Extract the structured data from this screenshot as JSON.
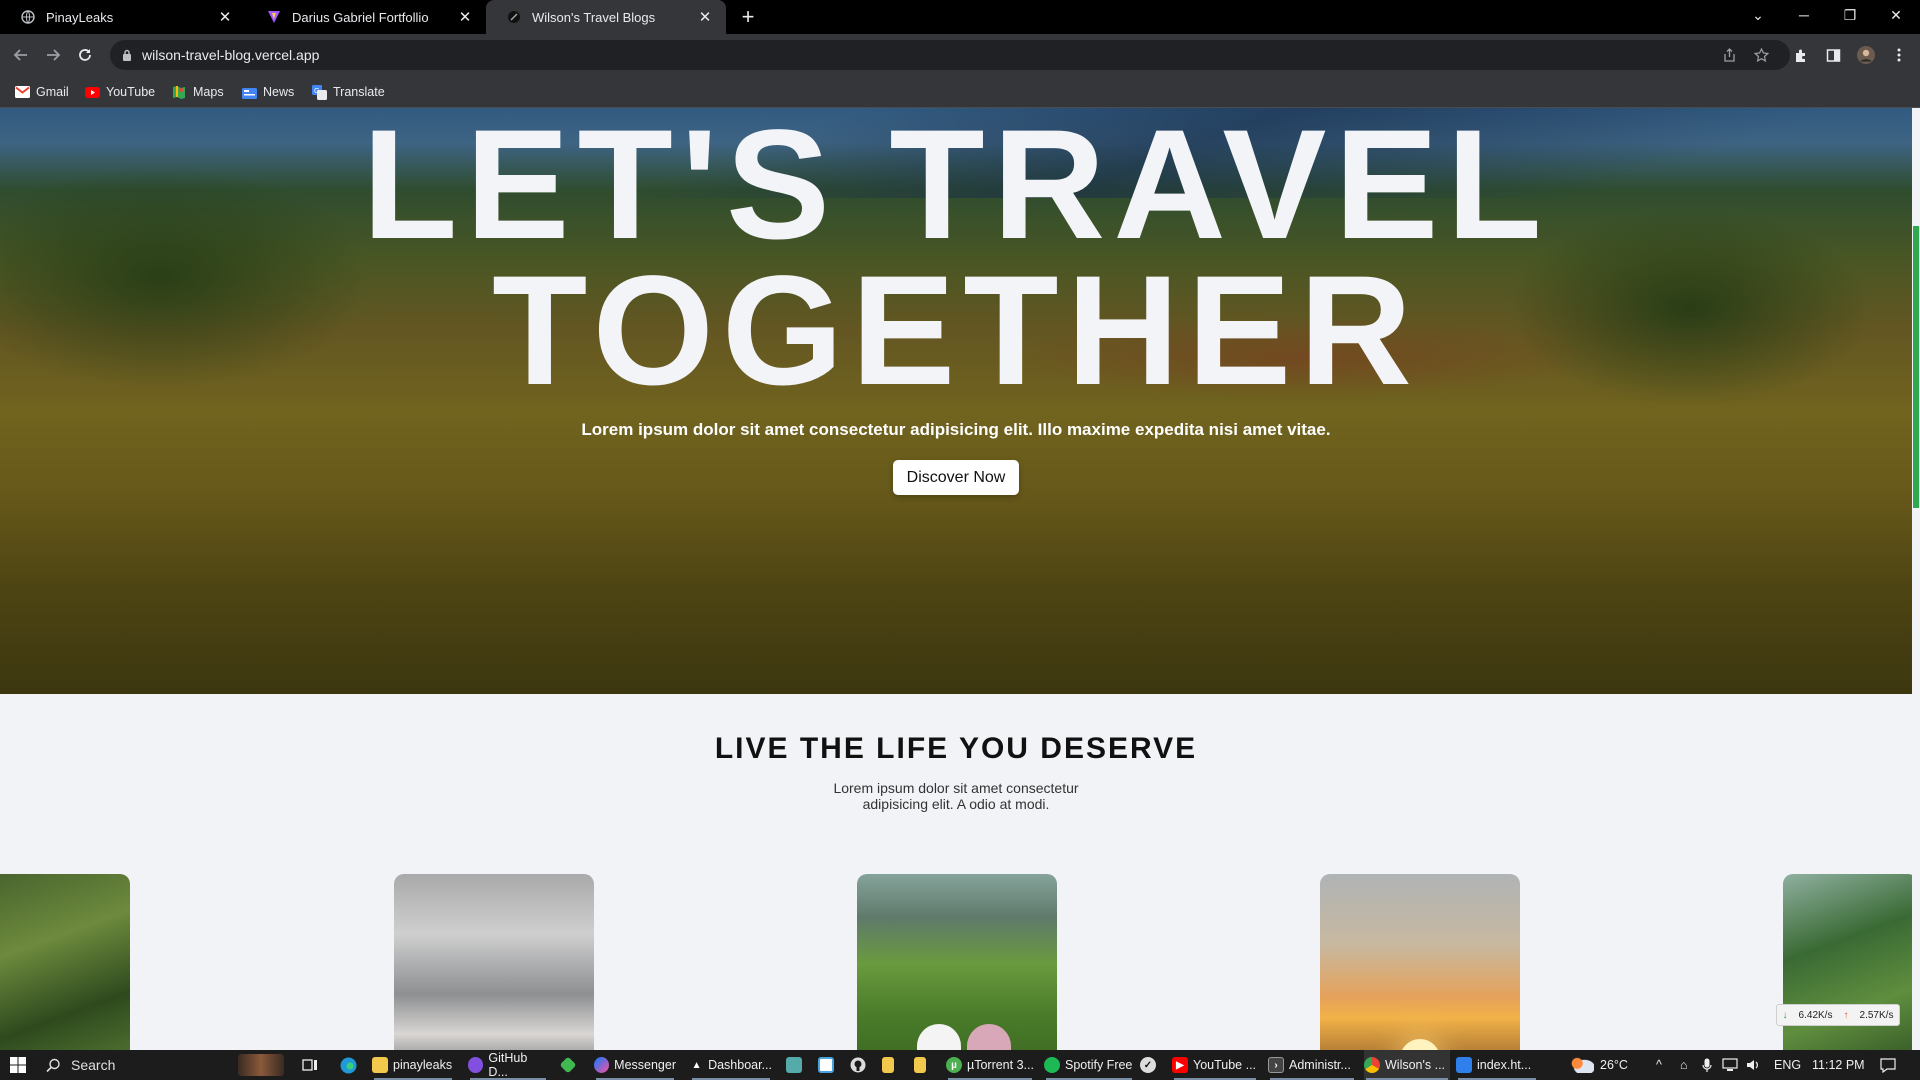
{
  "browser": {
    "tabs": [
      {
        "title": "PinayLeaks",
        "active": false
      },
      {
        "title": "Darius Gabriel Fortfollio",
        "active": false
      },
      {
        "title": "Wilson's Travel Blogs",
        "active": true
      }
    ],
    "url": "wilson-travel-blog.vercel.app",
    "bookmarks": [
      {
        "label": "Gmail",
        "icon": "gmail-icon"
      },
      {
        "label": "YouTube",
        "icon": "youtube-icon"
      },
      {
        "label": "Maps",
        "icon": "maps-icon"
      },
      {
        "label": "News",
        "icon": "news-icon"
      },
      {
        "label": "Translate",
        "icon": "translate-icon"
      }
    ]
  },
  "hero": {
    "title_line1": "LET'S TRAVEL",
    "title_line2": "TOGETHER",
    "subtitle": "Lorem ipsum dolor sit amet consectetur adipisicing elit. Illo maxime expedita nisi amet vitae.",
    "cta_label": "Discover Now"
  },
  "section": {
    "title": "LIVE THE LIFE YOU DESERVE",
    "description": "Lorem ipsum dolor sit amet consectetur adipisicing elit. A odio at modi."
  },
  "netspeed": {
    "down": "6.42K/s",
    "up": "2.57K/s"
  },
  "taskbar": {
    "search_placeholder": "Search",
    "apps": [
      {
        "label": "pinayleaks",
        "icon": "folder-icon",
        "color": "#f2c94c"
      },
      {
        "label": "GitHub D...",
        "icon": "github-desktop-icon",
        "color": "#8250df"
      },
      {
        "label": "",
        "icon": "git-icon",
        "color": "#3fb950"
      },
      {
        "label": "Messenger",
        "icon": "messenger-icon",
        "color": "#a033ff"
      },
      {
        "label": "Dashboar...",
        "icon": "vercel-icon",
        "color": "#ffffff"
      },
      {
        "label": "",
        "icon": "app-icon",
        "color": "#5aa"
      },
      {
        "label": "",
        "icon": "notepad-icon",
        "color": "#4aa3df"
      },
      {
        "label": "",
        "icon": "github-icon",
        "color": "#ddd"
      },
      {
        "label": "",
        "icon": "file-icon",
        "color": "#f2c94c"
      },
      {
        "label": "",
        "icon": "file-icon-2",
        "color": "#f2c94c"
      },
      {
        "label": "µTorrent 3...",
        "icon": "utorrent-icon",
        "color": "#4caf50"
      },
      {
        "label": "Spotify Free",
        "icon": "spotify-icon",
        "color": "#1db954"
      },
      {
        "label": "",
        "icon": "app-icon-2",
        "color": "#ddd"
      },
      {
        "label": "YouTube ...",
        "icon": "youtube-icon",
        "color": "#ff0000"
      },
      {
        "label": "Administr...",
        "icon": "terminal-icon",
        "color": "#888"
      },
      {
        "label": "Wilson's ...",
        "icon": "chrome-icon",
        "color": "#4285f4"
      },
      {
        "label": "index.ht...",
        "icon": "vscode-icon",
        "color": "#2f80ed"
      }
    ],
    "weather": "26°C",
    "language": "ENG",
    "time": "11:12 PM"
  }
}
